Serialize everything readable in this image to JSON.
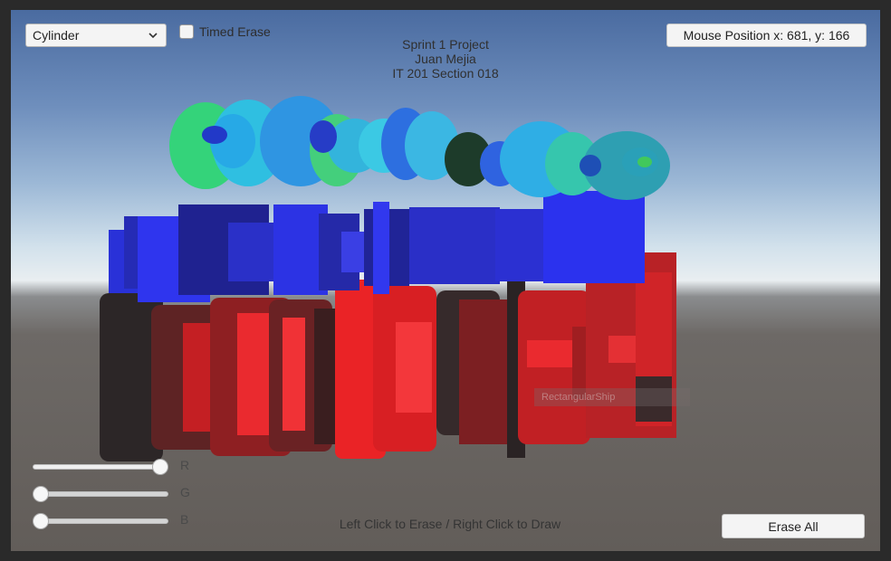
{
  "toolbar": {
    "shape_select": "Cylinder",
    "timed_erase_label": "Timed Erase",
    "timed_erase_checked": false
  },
  "header": {
    "line1": "Sprint 1 Project",
    "line2": "Juan Mejia",
    "line3": "IT 201 Section 018"
  },
  "mouse_position": "Mouse Position x: 681, y: 166",
  "scene_label": "RectangularShip",
  "sliders": [
    {
      "label": "R",
      "value": 1.0
    },
    {
      "label": "G",
      "value": 0.0
    },
    {
      "label": "B",
      "value": 0.0
    }
  ],
  "footer": {
    "instructions": "Left Click to Erase / Right Click to Draw",
    "erase_all_label": "Erase All"
  },
  "colors": {
    "sky_top": "#4a6ba0",
    "horizon": "#e9eef1",
    "ground": "#625d59",
    "red_shapes": "#e8262a",
    "blue_shapes": "#2b2fd6",
    "teal_shapes": "#3ec1d9"
  }
}
